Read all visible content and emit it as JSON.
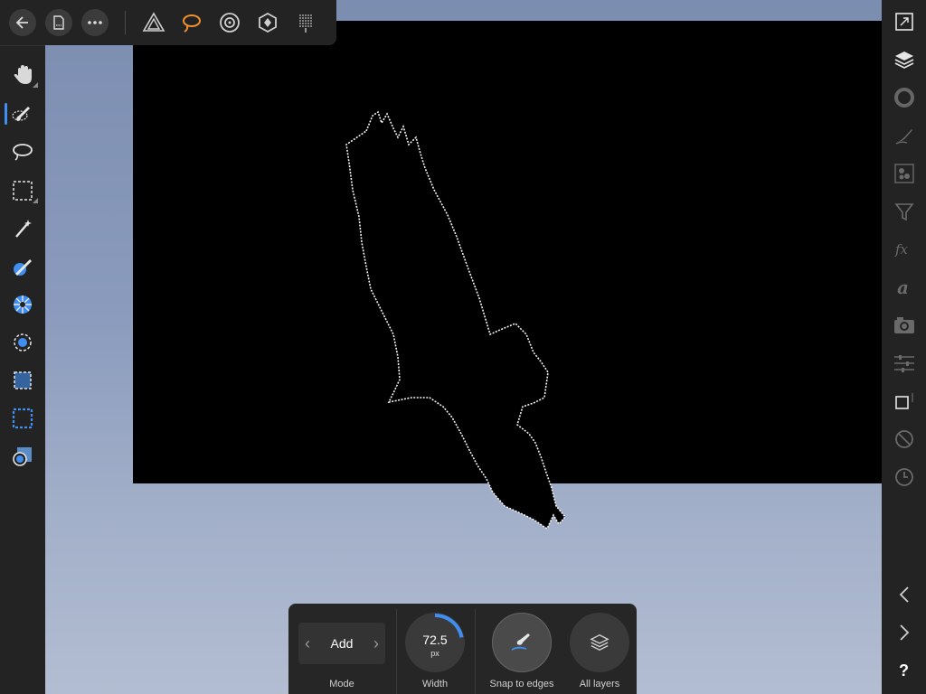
{
  "top_toolbar": {
    "back_icon": "back-arrow-icon",
    "document_icon": "document-icon",
    "more_icon": "more-icon",
    "personas": [
      "photo-persona-icon",
      "liquify-persona-icon",
      "develop-persona-icon",
      "tone-mapping-persona-icon",
      "export-persona-icon"
    ],
    "active_persona_color": "#f0902c"
  },
  "left_tools": [
    {
      "name": "view-tool-icon"
    },
    {
      "name": "selection-brush-tool-icon",
      "active": true
    },
    {
      "name": "freehand-selection-tool-icon"
    },
    {
      "name": "rectangular-marquee-tool-icon"
    },
    {
      "name": "flood-select-tool-icon"
    },
    {
      "name": "color-picker-tool-icon"
    },
    {
      "name": "radial-tool-icon"
    },
    {
      "name": "circle-select-tool-icon"
    },
    {
      "name": "dashed-square-tool-icon"
    },
    {
      "name": "quick-mask-tool-icon"
    },
    {
      "name": "gradient-tool-icon"
    }
  ],
  "right_studios": [
    "navigator-icon",
    "layers-icon",
    "color-icon",
    "brushes-icon",
    "channels-icon",
    "filter-icon",
    "fx-icon",
    "text-styles-icon",
    "stock-icon",
    "adjustments-icon",
    "transform-icon",
    "no-entry-icon",
    "history-icon"
  ],
  "right_nav": {
    "prev_icon": "chevron-left-icon",
    "next_icon": "chevron-right-icon",
    "help_label": "?"
  },
  "context": {
    "mode_value": "Add",
    "mode_label": "Mode",
    "width_value": "72.5",
    "width_unit": "px",
    "width_label": "Width",
    "width_fraction": 0.22,
    "snap_label": "Snap to edges",
    "all_layers_label": "All layers",
    "accent": "#3f8ef0"
  }
}
